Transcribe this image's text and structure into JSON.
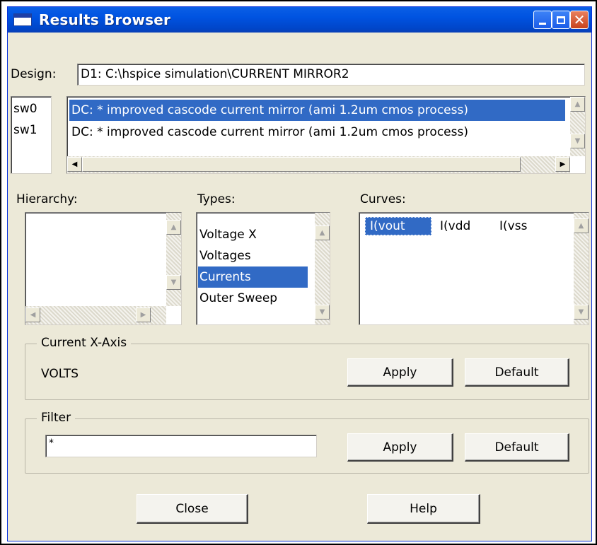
{
  "window": {
    "title": "Results Browser"
  },
  "design": {
    "label": "Design:",
    "value": "D1: C:\\hspice simulation\\CURRENT MIRROR2"
  },
  "sweeps": [
    {
      "id": "sw0",
      "desc": "DC: * improved cascode current mirror (ami 1.2um cmos process)"
    },
    {
      "id": "sw1",
      "desc": "DC: * improved cascode current mirror (ami 1.2um cmos process)"
    }
  ],
  "hierarchy": {
    "label": "Hierarchy:",
    "items": []
  },
  "types": {
    "label": "Types:",
    "items": [
      "Voltage X",
      "Voltages",
      "Currents",
      "Outer Sweep"
    ],
    "selected": "Currents"
  },
  "curves": {
    "label": "Curves:",
    "items": [
      "I(vout",
      "I(vdd",
      "I(vss"
    ],
    "selected": "I(vout"
  },
  "x_axis": {
    "title": "Current X-Axis",
    "value": "VOLTS",
    "apply": "Apply",
    "default": "Default"
  },
  "filter": {
    "title": "Filter",
    "value": "*",
    "apply": "Apply",
    "default": "Default"
  },
  "footer": {
    "close": "Close",
    "help": "Help"
  },
  "colors": {
    "selection": "#316ac5",
    "titlebar": "#0053e1",
    "dialog": "#ece9d8"
  }
}
